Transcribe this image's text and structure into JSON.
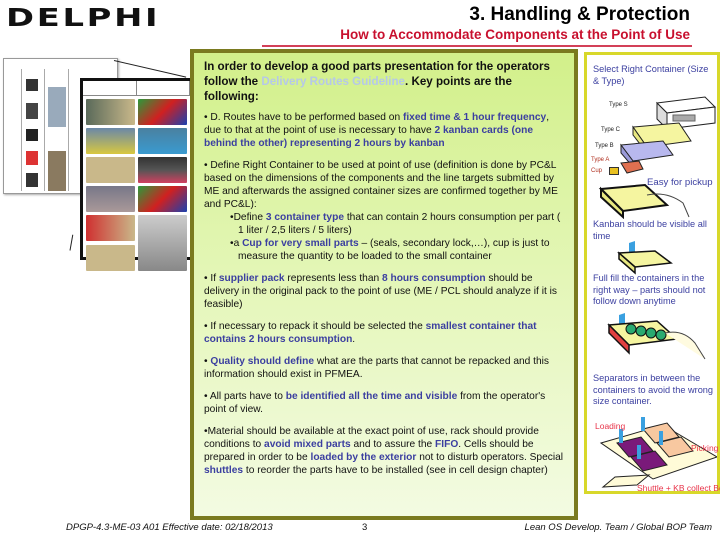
{
  "header": {
    "logo": "DELPHI",
    "title": "3. Handling & Protection",
    "subtitle": "How to Accommodate Components at the Point of Use"
  },
  "main": {
    "intro_1": "In order to develop a good parts presentation for the operators follow the ",
    "intro_link": "Delivery Routes Guideline",
    "intro_2": ". Key points are the following:",
    "b1_1": "• D. Routes have to be performed based on ",
    "b1_h1": "fixed time & 1 hour frequency",
    "b1_2": ", due to that at the point of use is necessary to have ",
    "b1_h2": "2 kanban cards (one behind the other) representing 2 hours by kanban",
    "b2_1": "• Define Right Container to be used at point of use (definition is done by PC&L based on the dimensions of the components and the line targets submitted by ME and afterwards the assigned container sizes are confirmed together by ME and PC&L):",
    "b2_s1_1": "•Define ",
    "b2_s1_h": "3 container type",
    "b2_s1_2": " that can contain 2 hours consumption per part ( 1 liter / 2,5 liters / 5 liters)",
    "b2_s2_1": "•a ",
    "b2_s2_h": "Cup for very small parts",
    "b2_s2_2": " – (seals, secondary lock,…), cup is just to measure the quantity to be loaded to the small container",
    "b3_1": "• If ",
    "b3_h1": "supplier pack",
    "b3_2": " represents less than ",
    "b3_h2": "8 hours consumption",
    "b3_3": " should be delivery in the original pack to the point of use (ME / PCL should analyze if it is feasible)",
    "b4_1": "• If necessary to repack it should be selected the ",
    "b4_h": "smallest container that contains 2 hours consumption",
    "b4_2": ".",
    "b5_h": "Quality should define",
    "b5_1": " what are the parts that cannot be repacked and this information should exist in PFMEA.",
    "b6_1": "• All parts have to ",
    "b6_h": "be identified all the time and visible",
    "b6_2": " from the operator's point of view.",
    "b7_1": "•Material should be available at the exact point of use, rack should provide conditions to ",
    "b7_h1": "avoid mixed parts",
    "b7_2": " and to assure the ",
    "b7_h2": "FIFO",
    "b7_3": ". Cells should be prepared in order to be ",
    "b7_h3": "loaded by the exterior",
    "b7_4": " not to disturb operators. Special ",
    "b7_h4": "shuttles",
    "b7_5": " to reorder the parts have to be installed (see in cell design chapter)"
  },
  "side": {
    "cap1": "Select Right Container (Size & Type)",
    "types": [
      "Type S",
      "Type C",
      "Type B",
      "Type A",
      "Cup"
    ],
    "cap2": "Easy for pickup",
    "cap3": "Kanban should be visible all time",
    "cap4": "Full fill the containers in the right way – parts should not follow down anytime",
    "cap5": "Separators in between the containers to avoid the wrong size container.",
    "loading": "Loading",
    "picking": "Picking",
    "shuttle": "Shuttle + KB collect Box"
  },
  "footer": {
    "doc_id": "DPGP-4.3-ME-03 A01  Effective date: 02/18/2013",
    "page": "3",
    "team": "Lean OS Develop. Team / Global BOP Team"
  }
}
